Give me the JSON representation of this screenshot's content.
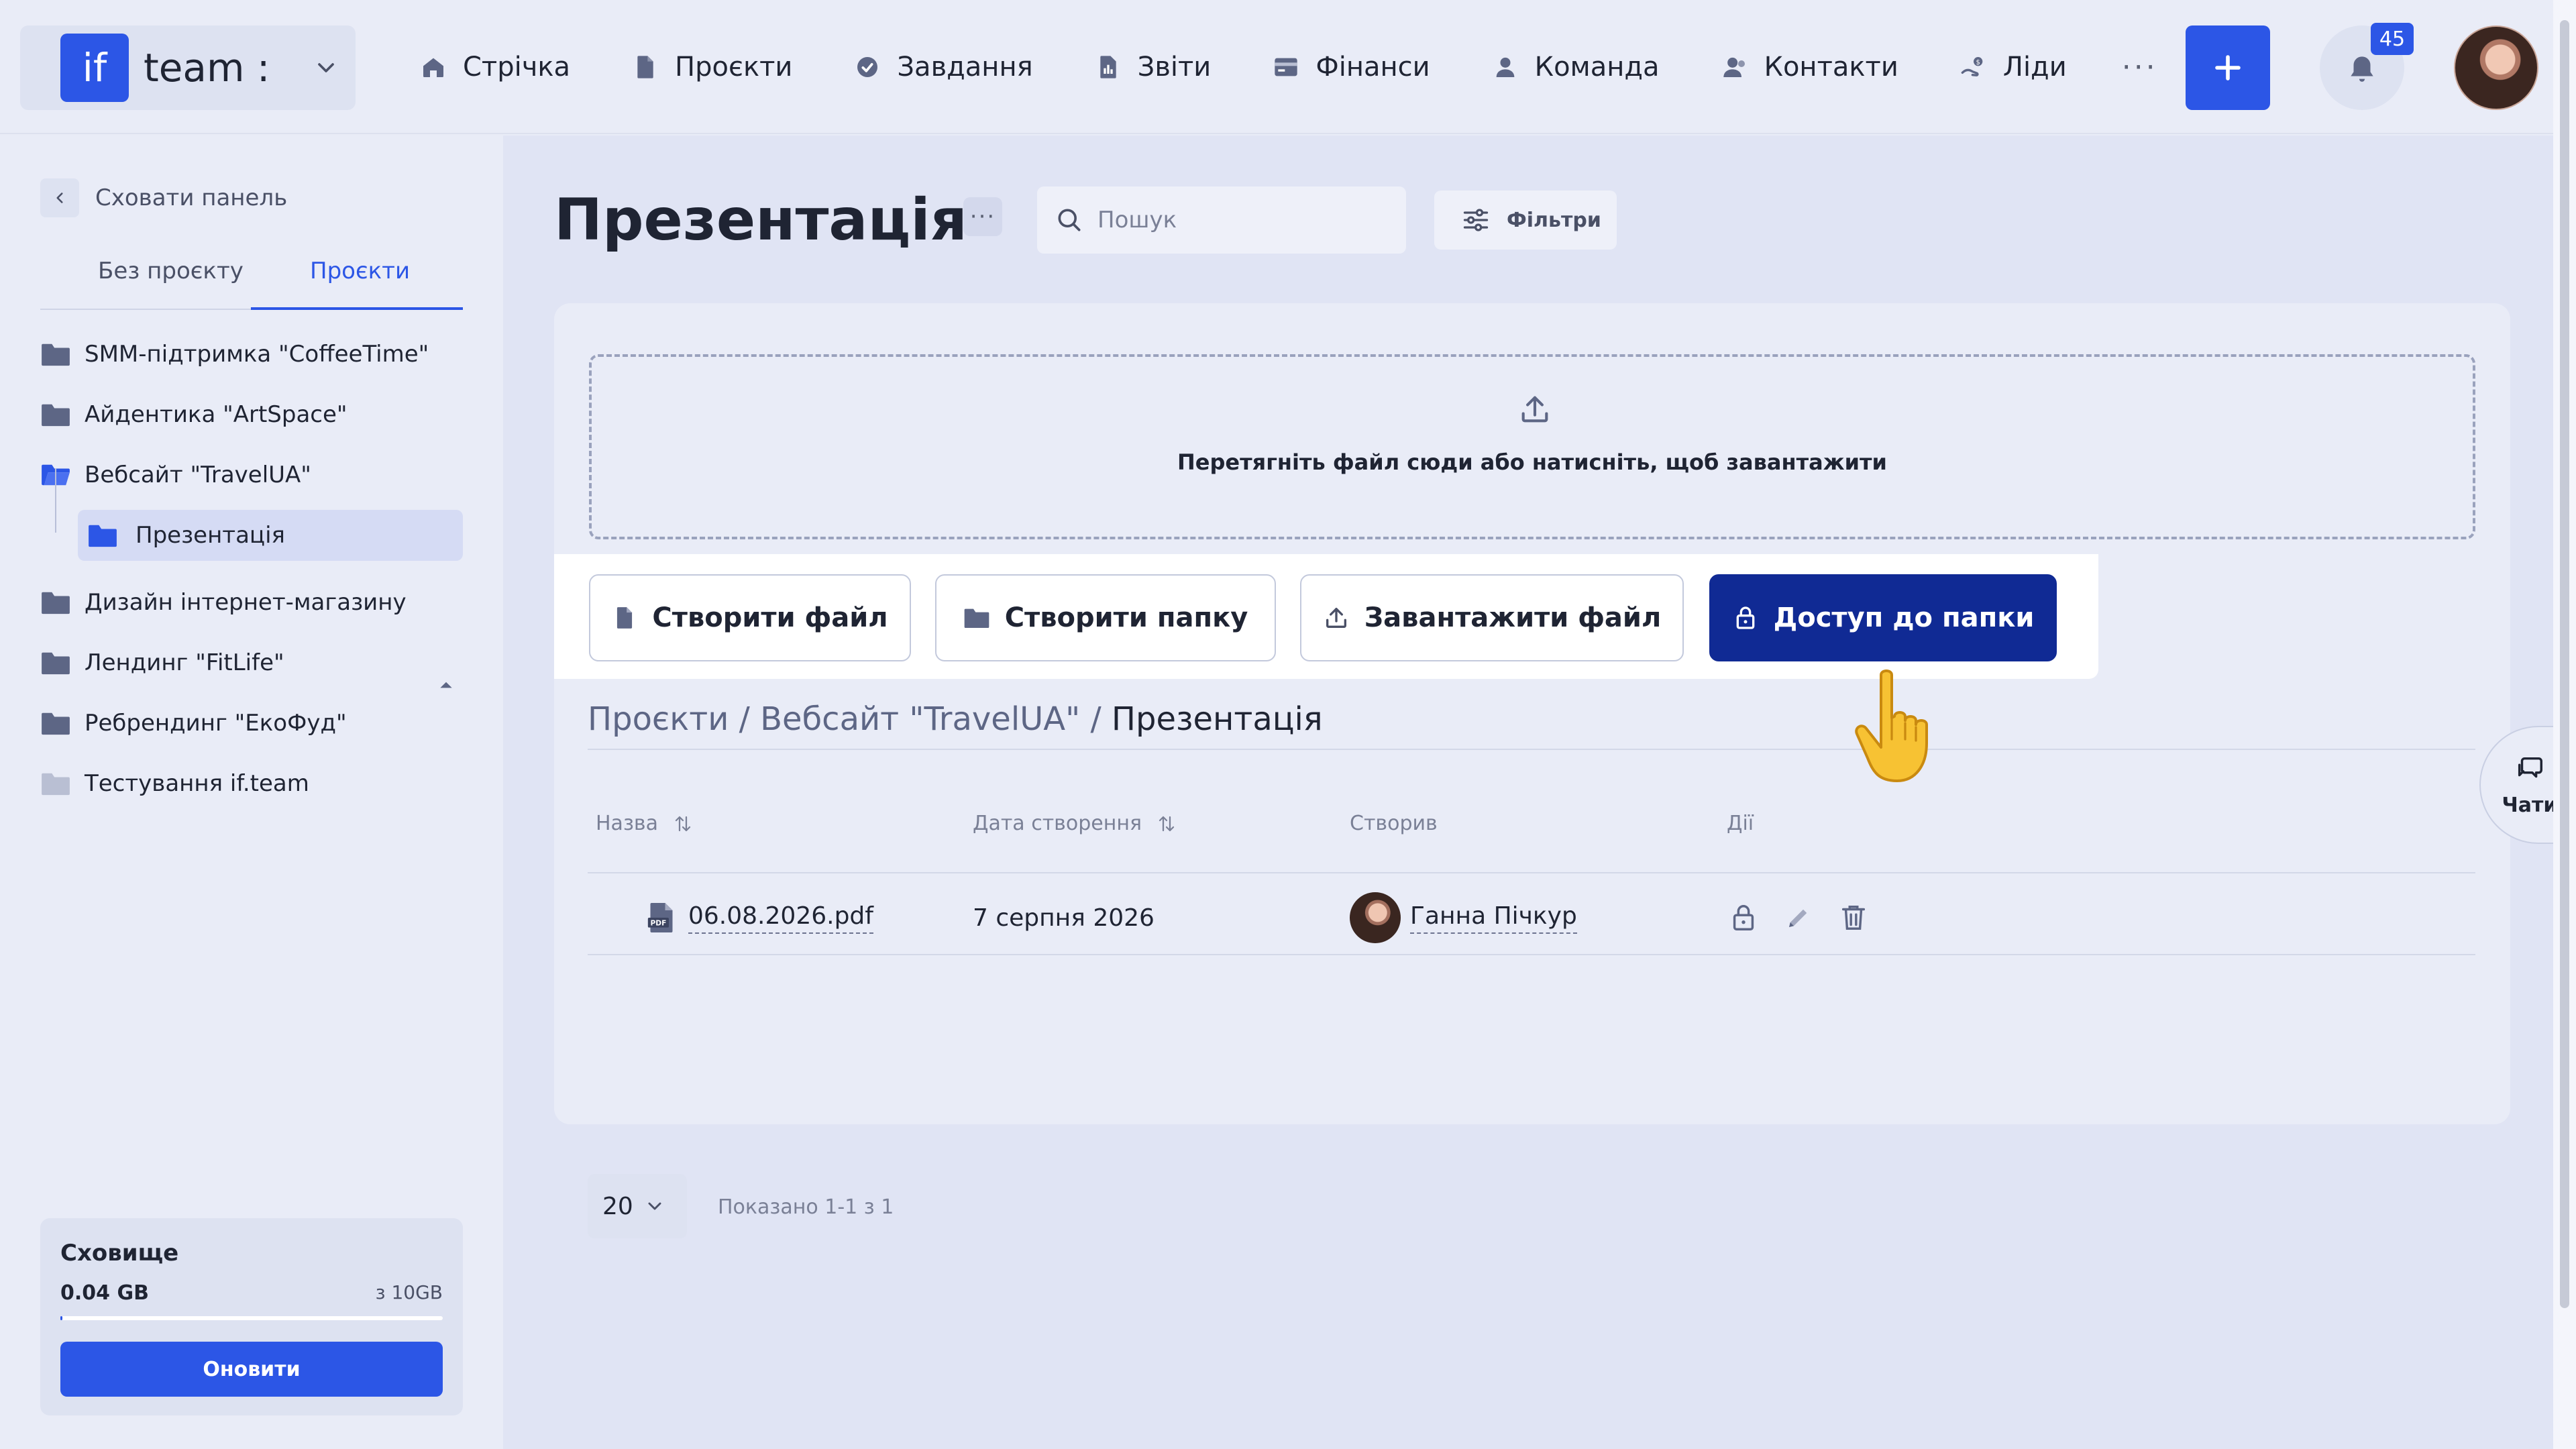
{
  "topbar": {
    "brand_logo": "if",
    "brand_name": "team :",
    "nav": [
      {
        "label": "Стрічка",
        "icon": "home-icon"
      },
      {
        "label": "Проєкти",
        "icon": "file-icon"
      },
      {
        "label": "Завдання",
        "icon": "check-circle-icon"
      },
      {
        "label": "Звіти",
        "icon": "report-icon"
      },
      {
        "label": "Фінанси",
        "icon": "wallet-icon"
      },
      {
        "label": "Команда",
        "icon": "user-icon"
      },
      {
        "label": "Контакти",
        "icon": "contacts-icon"
      },
      {
        "label": "Ліди",
        "icon": "leads-icon"
      }
    ],
    "more": "···",
    "notifications_count": "45"
  },
  "sidebar": {
    "hide_label": "Сховати панель",
    "tabs": [
      "Без проєкту",
      "Проєкти"
    ],
    "projects": [
      "SMM-підтримка \"CoffeeTime\"",
      "Айдентика \"ArtSpace\"",
      "Вебсайт \"TravelUA\"",
      "Дизайн інтернет-магазину",
      "Лендинг \"FitLife\"",
      "Ребрендинг \"ЕкоФуд\"",
      "Тестування if.team"
    ],
    "subfolder": "Презентація",
    "storage": {
      "title": "Сховище",
      "used": "0.04 GB",
      "total": "з 10GB",
      "used_fraction": 0.004,
      "button": "Оновити"
    }
  },
  "main": {
    "title": "Презентація",
    "title_more": "···",
    "search_placeholder": "Пошук",
    "filters_label": "Фільтри",
    "dropzone_text": "Перетягніть файл сюди або натисніть, щоб завантажити",
    "actions": {
      "create_file": "Створити файл",
      "create_folder": "Створити папку",
      "upload_file": "Завантажити файл",
      "folder_access": "Доступ до папки"
    },
    "breadcrumb": {
      "path": "Проєкти / Вебсайт \"TravelUA\" / ",
      "current": "Презентація"
    },
    "table": {
      "columns": [
        "Назва",
        "Дата створення",
        "Створив",
        "Дії"
      ],
      "rows": [
        {
          "name": "06.08.2026.pdf",
          "date": "7 серпня 2026",
          "author": "Ганна Пічкур"
        }
      ]
    },
    "pagination": {
      "per_page": "20",
      "showing": "Показано 1-1 з 1"
    },
    "chats_label": "Чати"
  },
  "colors": {
    "accent": "#2c56e6",
    "primary_dark": "#102a94",
    "background": "#e9ecf7"
  }
}
